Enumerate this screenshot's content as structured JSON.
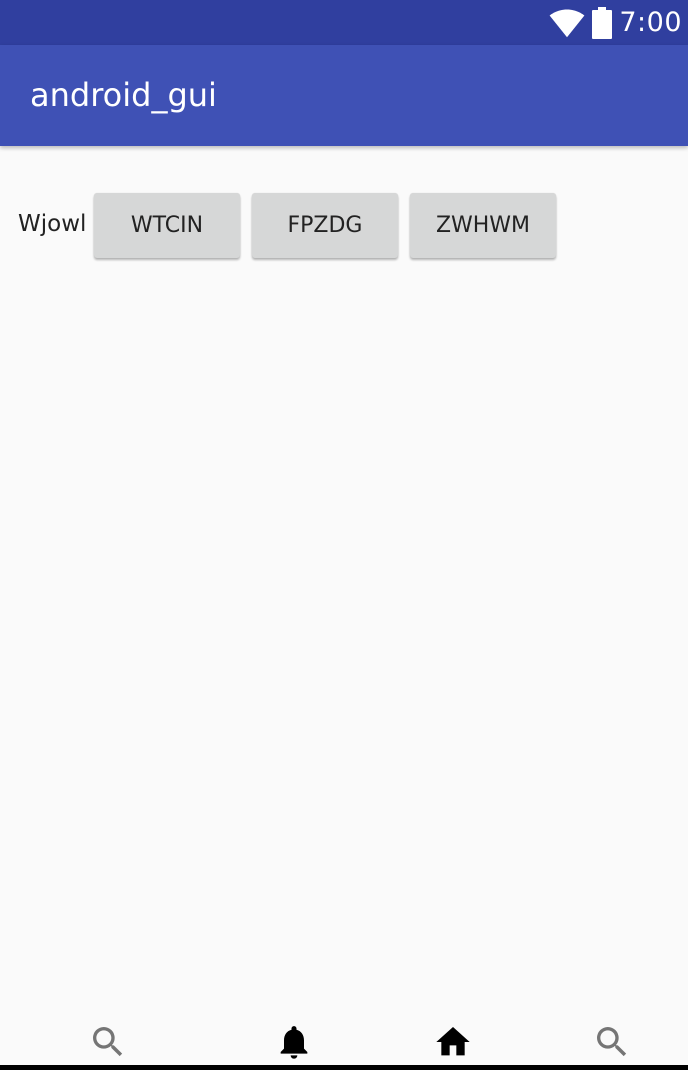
{
  "status_bar": {
    "time": "7:00",
    "wifi_icon": "wifi-icon",
    "battery_icon": "battery-icon",
    "color": "#303f9f"
  },
  "app_bar": {
    "title": "android_gui",
    "color": "#3f51b5"
  },
  "main": {
    "label": "Wjowl",
    "buttons": [
      {
        "label": "WTCIN"
      },
      {
        "label": "FPZDG"
      },
      {
        "label": "ZWHWM"
      }
    ],
    "button_color": "#d6d7d7"
  },
  "bottom_nav": {
    "items": [
      {
        "icon": "search-icon",
        "color": "#757575"
      },
      {
        "icon": "notifications-bell-icon",
        "color": "#000000"
      },
      {
        "icon": "home-icon",
        "color": "#000000"
      },
      {
        "icon": "search-icon",
        "color": "#757575"
      }
    ]
  }
}
